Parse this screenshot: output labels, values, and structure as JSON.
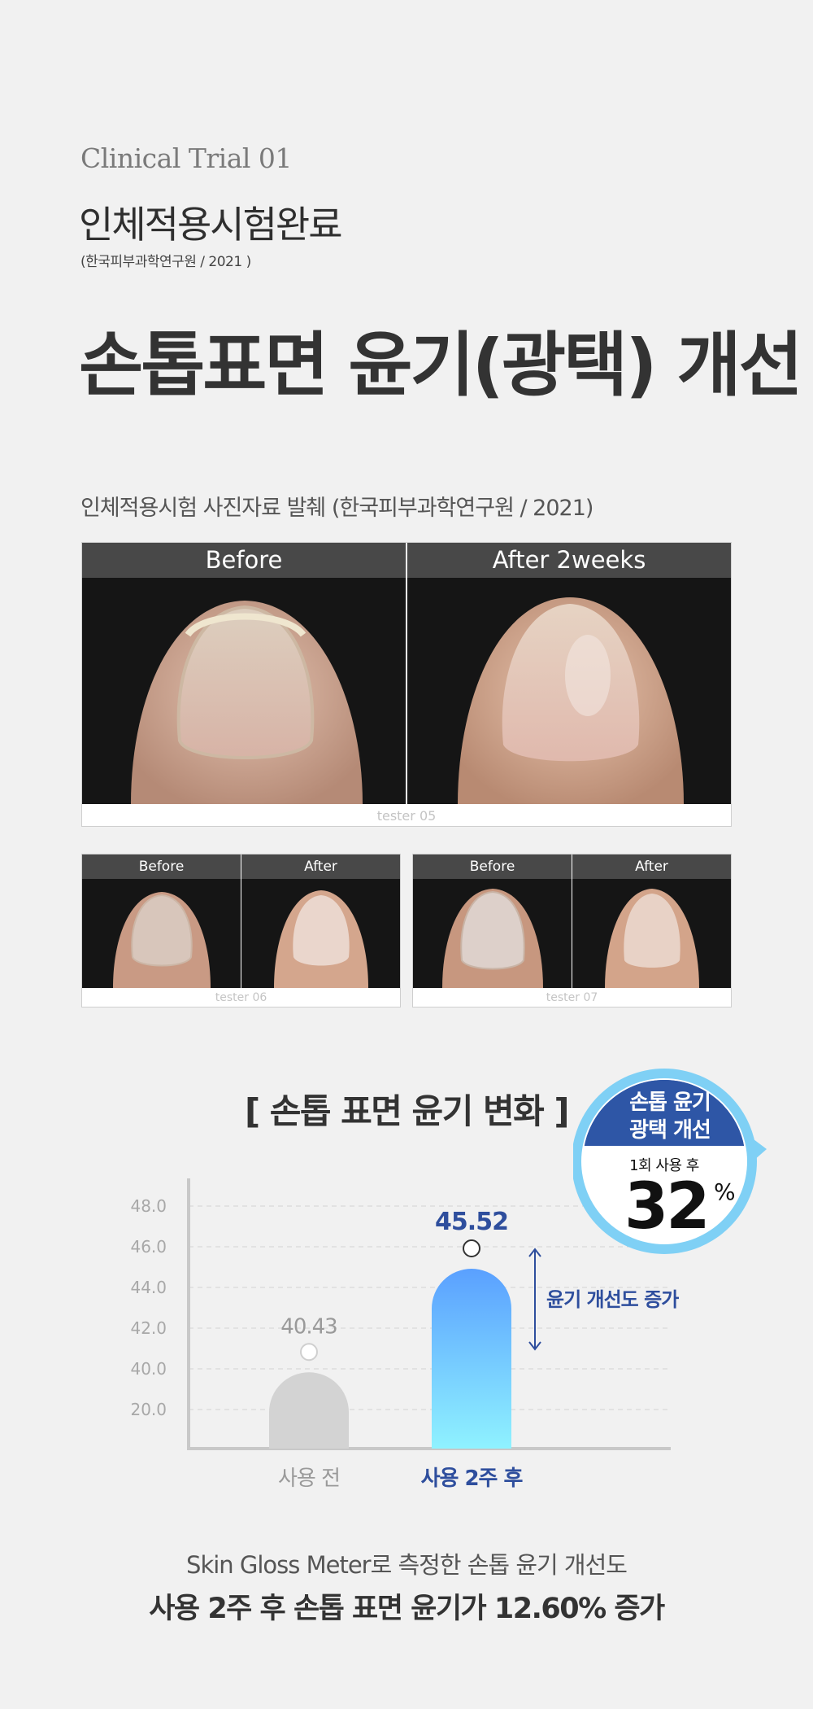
{
  "header": {
    "eyebrow": "Clinical Trial 01",
    "subtitle": "인체적용시험완료",
    "note": "(한국피부과학연구원 / 2021 )",
    "title": "손톱표면 윤기(광택) 개선"
  },
  "photos": {
    "caption": "인체적용시험 사진자료 발췌 (한국피부과학연구원 / 2021)",
    "main": {
      "before": "Before",
      "after": "After 2weeks",
      "tester": "tester 05"
    },
    "small": [
      {
        "before": "Before",
        "after": "After",
        "tester": "tester 06"
      },
      {
        "before": "Before",
        "after": "After",
        "tester": "tester 07"
      }
    ]
  },
  "chart_title": "[ 손톱 표면 윤기 변화 ]",
  "chart_data": {
    "type": "bar",
    "categories": [
      "사용 전",
      "사용 2주 후"
    ],
    "values": [
      40.43,
      45.52
    ],
    "value_labels": [
      "40.43",
      "45.52"
    ],
    "y_ticks": [
      "48.0",
      "46.0",
      "44.0",
      "42.0",
      "40.0",
      "20.0"
    ],
    "annotation": "윤기 개선도 증가",
    "grid": true,
    "colors": {
      "before_bar": "#d3d3d3",
      "after_bar_top": "#5aa0ff",
      "after_bar_bottom": "#8ff2ff",
      "after_text": "#2e4e9d",
      "before_text": "#9a9a9a",
      "axis": "#c8c8c8"
    }
  },
  "badge": {
    "line1": "손톱 윤기",
    "line2": "광택 개선",
    "sub": "1회 사용 후",
    "value": "32",
    "unit": "%",
    "colors": {
      "ring": "#7fd0f5",
      "top": "#2e56a6"
    }
  },
  "footer": {
    "line1": "Skin Gloss Meter로 측정한 손톱 윤기 개선도",
    "line2": "사용 2주 후 손톱 표면 윤기가 12.60% 증가"
  }
}
